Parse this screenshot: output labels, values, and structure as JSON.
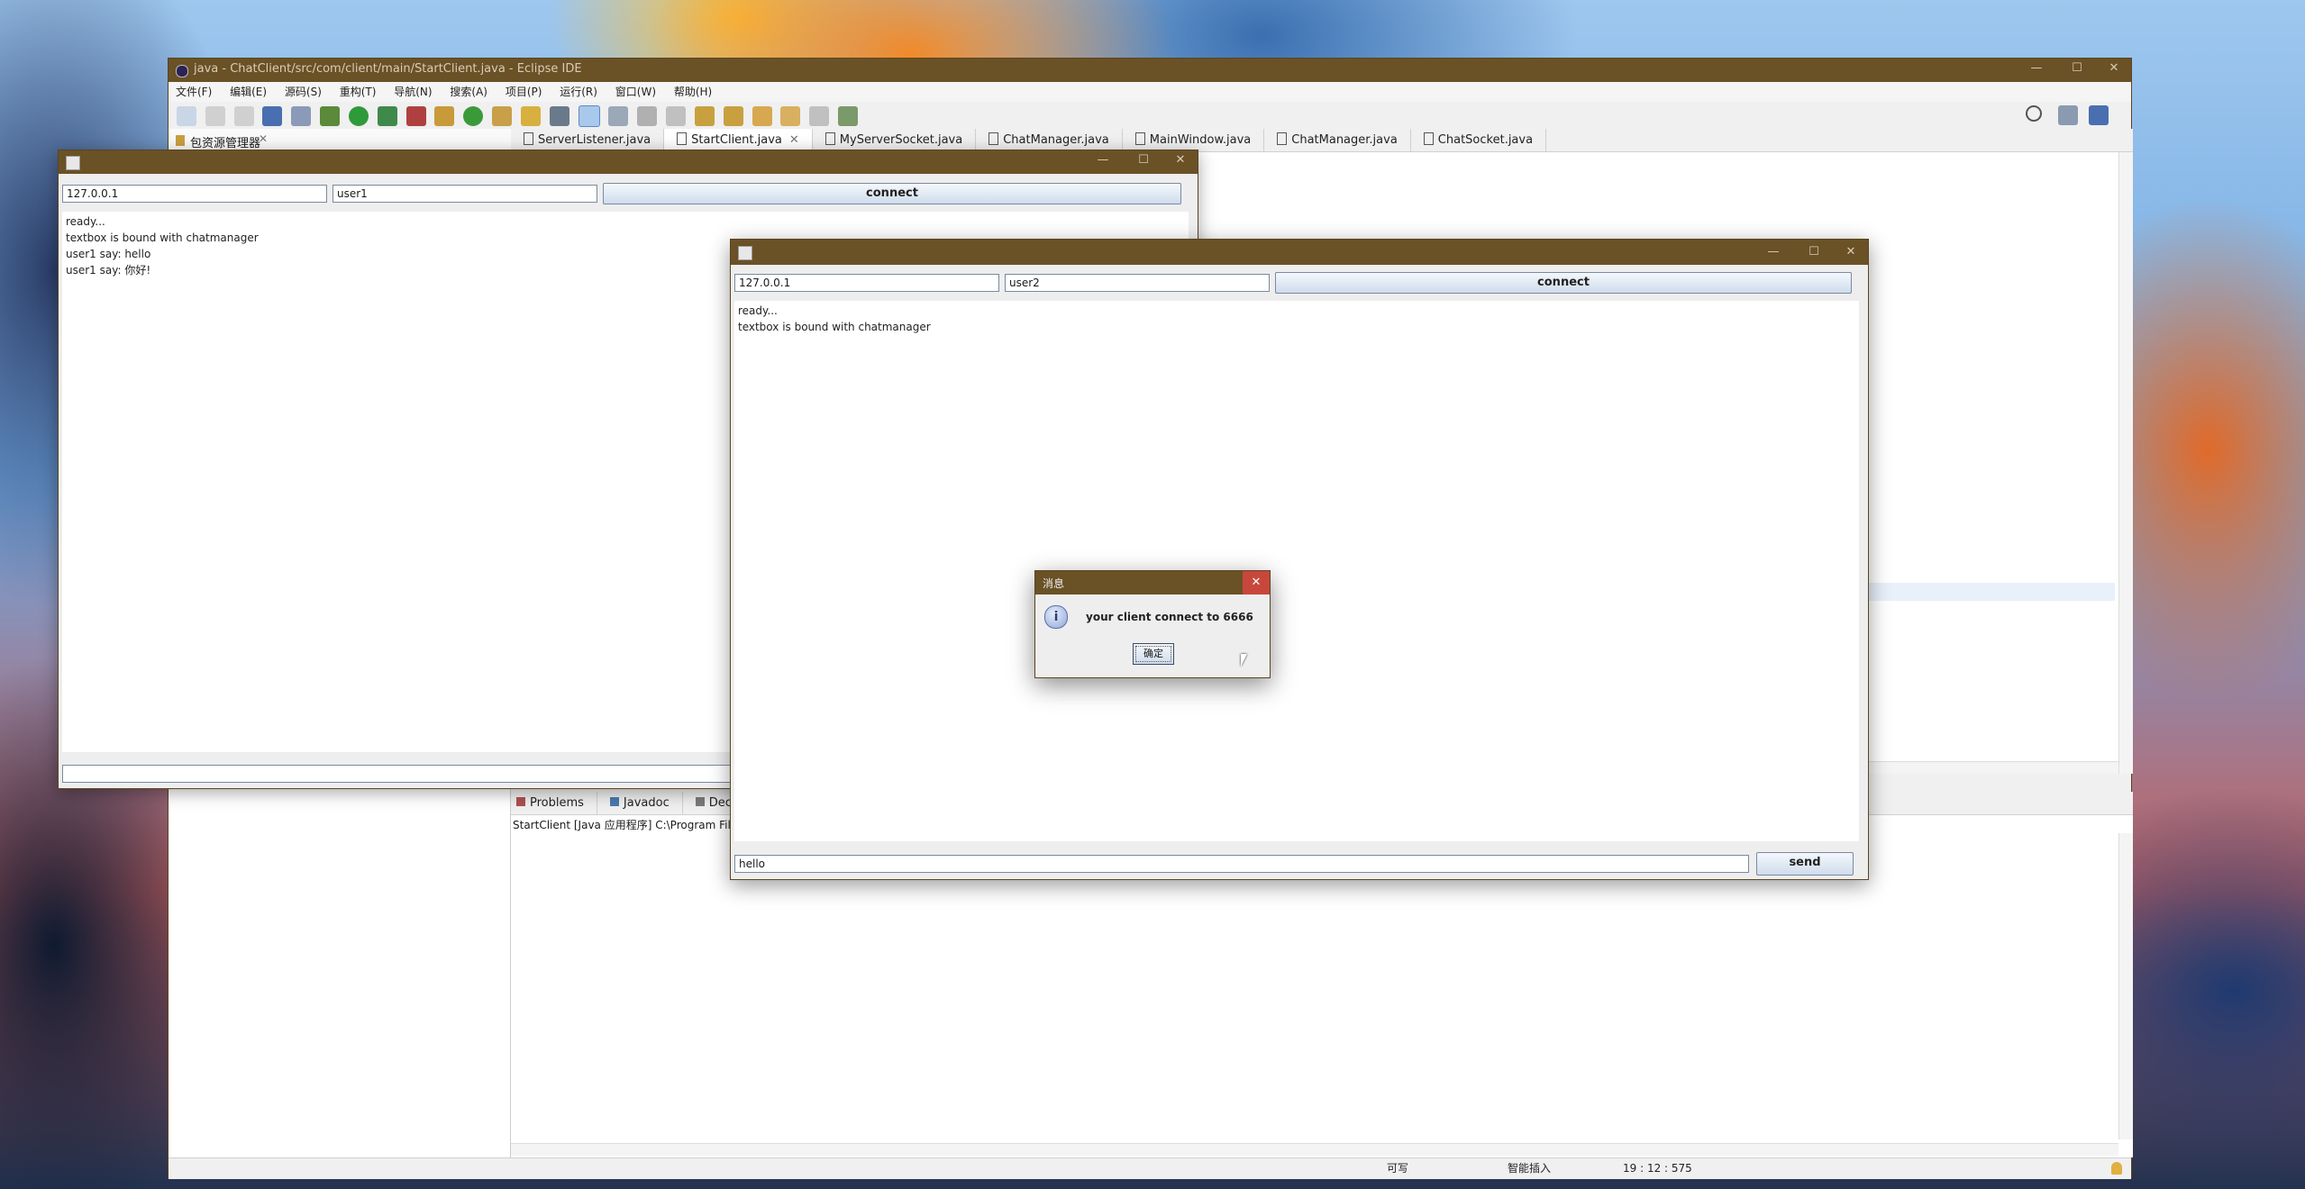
{
  "eclipse": {
    "title": "java - ChatClient/src/com/client/main/StartClient.java - Eclipse IDE",
    "menu": [
      "文件(F)",
      "编辑(E)",
      "源码(S)",
      "重构(T)",
      "导航(N)",
      "搜索(A)",
      "项目(P)",
      "运行(R)",
      "窗口(W)",
      "帮助(H)"
    ],
    "package_explorer": "包资源管理器",
    "editor_tabs": [
      "ServerListener.java",
      "StartClient.java",
      "MyServerSocket.java",
      "ChatManager.java",
      "MainWindow.java",
      "ChatManager.java",
      "ChatSocket.java"
    ],
    "active_tab": 1,
    "bottom_tabs": [
      "Problems",
      "Javadoc",
      "Declaratio"
    ],
    "console_line": "StartClient [Java 应用程序] C:\\Program File",
    "status": {
      "writable": "可写",
      "insert_mode": "智能插入",
      "position": "19 : 12 : 575"
    }
  },
  "client1": {
    "ip": "127.0.0.1",
    "user": "user1",
    "connect_label": "connect",
    "log": [
      "ready...",
      "textbox is bound with chatmanager",
      "user1 say: hello",
      "user1 say: 你好!"
    ]
  },
  "client2": {
    "ip": "127.0.0.1",
    "user": "user2",
    "connect_label": "connect",
    "log": [
      "ready...",
      "textbox is bound with chatmanager"
    ],
    "message_input": "hello",
    "send_label": "send"
  },
  "dialog": {
    "title": "消息",
    "message": "your client connect to 6666",
    "ok_label": "确定"
  },
  "colors": {
    "titlebar": "#6a5126",
    "accent": "#3a6fd8",
    "close_red": "#c8473c"
  }
}
